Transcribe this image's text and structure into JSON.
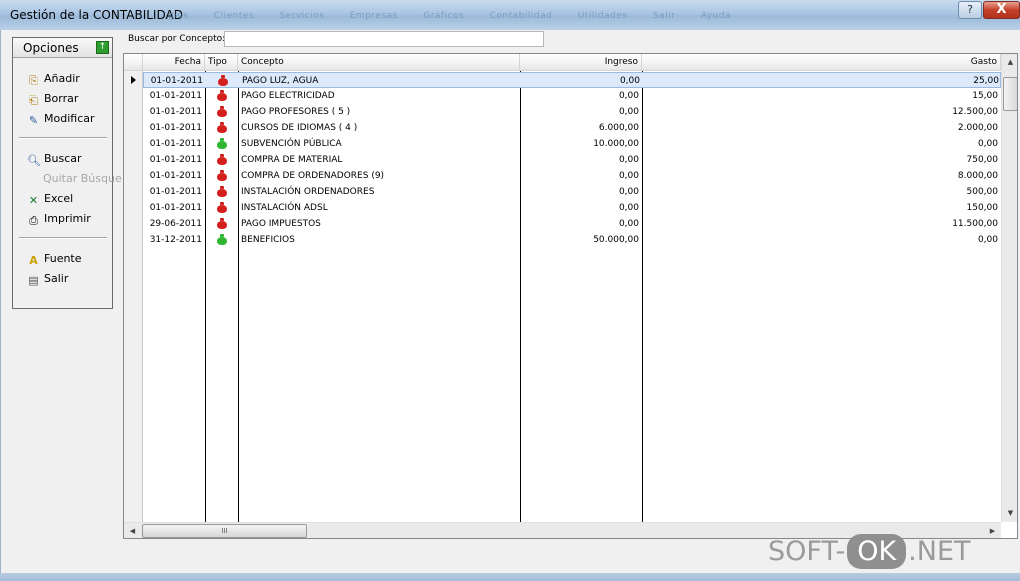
{
  "window": {
    "title": "Gestión de la CONTABILIDAD",
    "ghost_menu": [
      "gios",
      "Clientes",
      "Servicios",
      "Empresas",
      "Gráficos",
      "Contabilidad",
      "Utilidades",
      "Salir",
      "Ayuda"
    ],
    "help_label": "?",
    "close_label": "X"
  },
  "options": {
    "title": "Opciones",
    "items": [
      {
        "label": "Añadir",
        "icon": "add-icon"
      },
      {
        "label": "Borrar",
        "icon": "delete-icon"
      },
      {
        "label": "Modificar",
        "icon": "edit-icon"
      },
      {
        "label": "Buscar",
        "icon": "search-icon"
      },
      {
        "label": "Quitar Búsque",
        "icon": ""
      },
      {
        "label": "Excel",
        "icon": "excel-icon"
      },
      {
        "label": "Imprimir",
        "icon": "printer-icon"
      },
      {
        "label": "Fuente",
        "icon": "font-icon"
      },
      {
        "label": "Salir",
        "icon": "exit-icon"
      }
    ]
  },
  "search": {
    "label": "Buscar por Concepto:",
    "value": ""
  },
  "grid": {
    "columns": [
      "Fecha",
      "Tipo",
      "Concepto",
      "Ingreso",
      "Gasto"
    ],
    "rows": [
      {
        "fecha": "01-01-2011",
        "tipo": "gasto",
        "concepto": "PAGO LUZ, AGUA",
        "ingreso": "0,00",
        "gasto": "25,00"
      },
      {
        "fecha": "01-01-2011",
        "tipo": "gasto",
        "concepto": "PAGO ELECTRICIDAD",
        "ingreso": "0,00",
        "gasto": "15,00"
      },
      {
        "fecha": "01-01-2011",
        "tipo": "gasto",
        "concepto": "PAGO PROFESORES ( 5 )",
        "ingreso": "0,00",
        "gasto": "12.500,00"
      },
      {
        "fecha": "01-01-2011",
        "tipo": "gasto",
        "concepto": "CURSOS DE IDIOMAS ( 4 )",
        "ingreso": "6.000,00",
        "gasto": "2.000,00"
      },
      {
        "fecha": "01-01-2011",
        "tipo": "ingreso",
        "concepto": "SUBVENCIÓN PÚBLICA",
        "ingreso": "10.000,00",
        "gasto": "0,00"
      },
      {
        "fecha": "01-01-2011",
        "tipo": "gasto",
        "concepto": "COMPRA DE MATERIAL",
        "ingreso": "0,00",
        "gasto": "750,00"
      },
      {
        "fecha": "01-01-2011",
        "tipo": "gasto",
        "concepto": "COMPRA DE ORDENADORES (9)",
        "ingreso": "0,00",
        "gasto": "8.000,00"
      },
      {
        "fecha": "01-01-2011",
        "tipo": "gasto",
        "concepto": "INSTALACIÓN ORDENADORES",
        "ingreso": "0,00",
        "gasto": "500,00"
      },
      {
        "fecha": "01-01-2011",
        "tipo": "gasto",
        "concepto": "INSTALACIÓN ADSL",
        "ingreso": "0,00",
        "gasto": "150,00"
      },
      {
        "fecha": "29-06-2011",
        "tipo": "gasto",
        "concepto": "PAGO IMPUESTOS",
        "ingreso": "0,00",
        "gasto": "11.500,00"
      },
      {
        "fecha": "31-12-2011",
        "tipo": "ingreso",
        "concepto": "BENEFICIOS",
        "ingreso": "50.000,00",
        "gasto": "0,00"
      }
    ],
    "selected_row": 0,
    "hscroll_grip": "III"
  },
  "colors": {
    "gasto": "#d41f1f",
    "ingreso": "#2fb52f",
    "selection": "#dbe9fb"
  },
  "watermark": {
    "left": "SOFT-",
    "box": "OK",
    "right": ".NET"
  }
}
